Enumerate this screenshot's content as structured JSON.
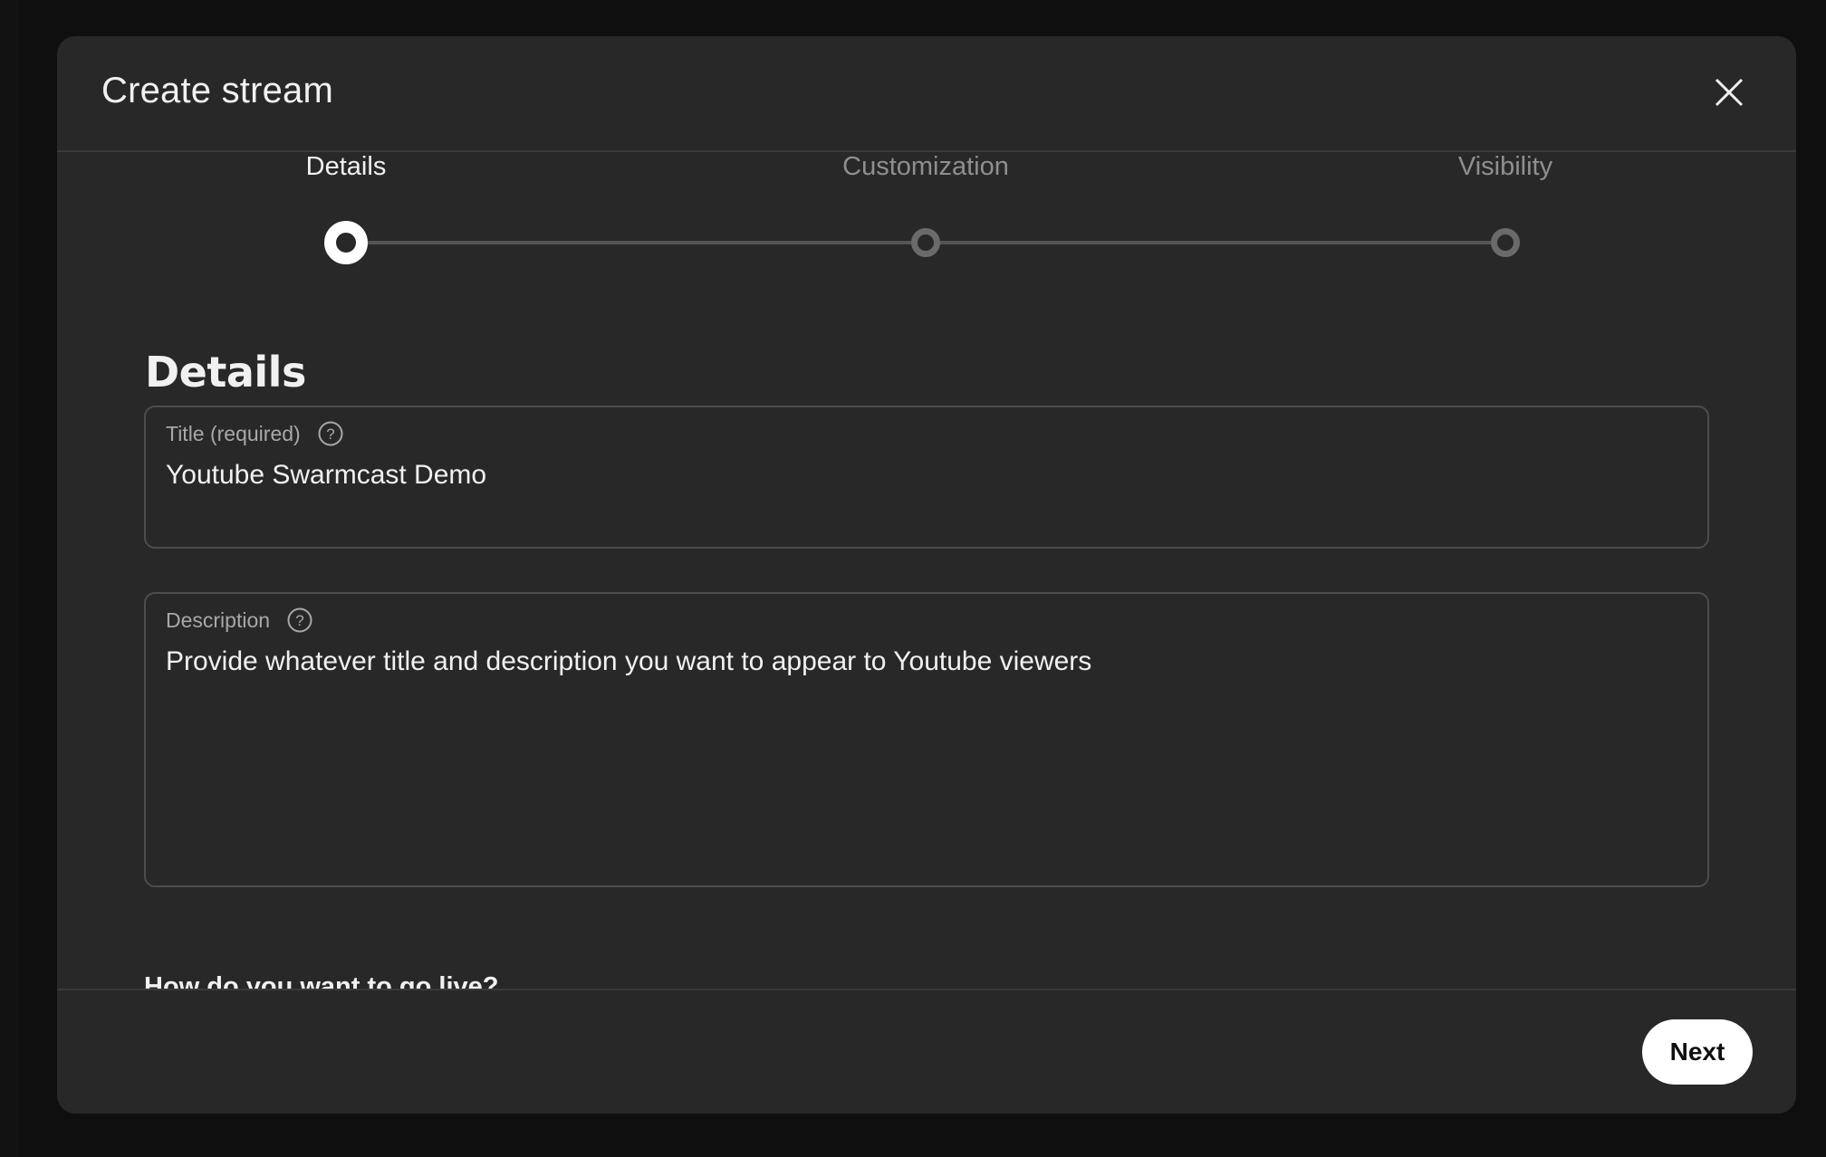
{
  "dialog": {
    "title": "Create stream",
    "close_icon": "close-icon"
  },
  "stepper": {
    "steps": [
      {
        "label": "Details",
        "state": "active"
      },
      {
        "label": "Customization",
        "state": "inactive"
      },
      {
        "label": "Visibility",
        "state": "inactive"
      }
    ]
  },
  "details": {
    "heading": "Details",
    "title_field": {
      "label": "Title (required)",
      "value": "Youtube Swarmcast Demo",
      "help_icon": "help-icon"
    },
    "description_field": {
      "label": "Description",
      "value": "Provide whatever title and description you want to appear to Youtube viewers",
      "help_icon": "help-icon"
    },
    "live_question": "How do you want to go live?"
  },
  "footer": {
    "next_label": "Next"
  },
  "colors": {
    "backdrop": "#0f0f0f",
    "dialog_bg": "#282828",
    "text_primary": "#f1f1f1",
    "text_secondary": "#a8a8a8",
    "border": "#4d4d4d",
    "button_bg": "#ffffff"
  }
}
